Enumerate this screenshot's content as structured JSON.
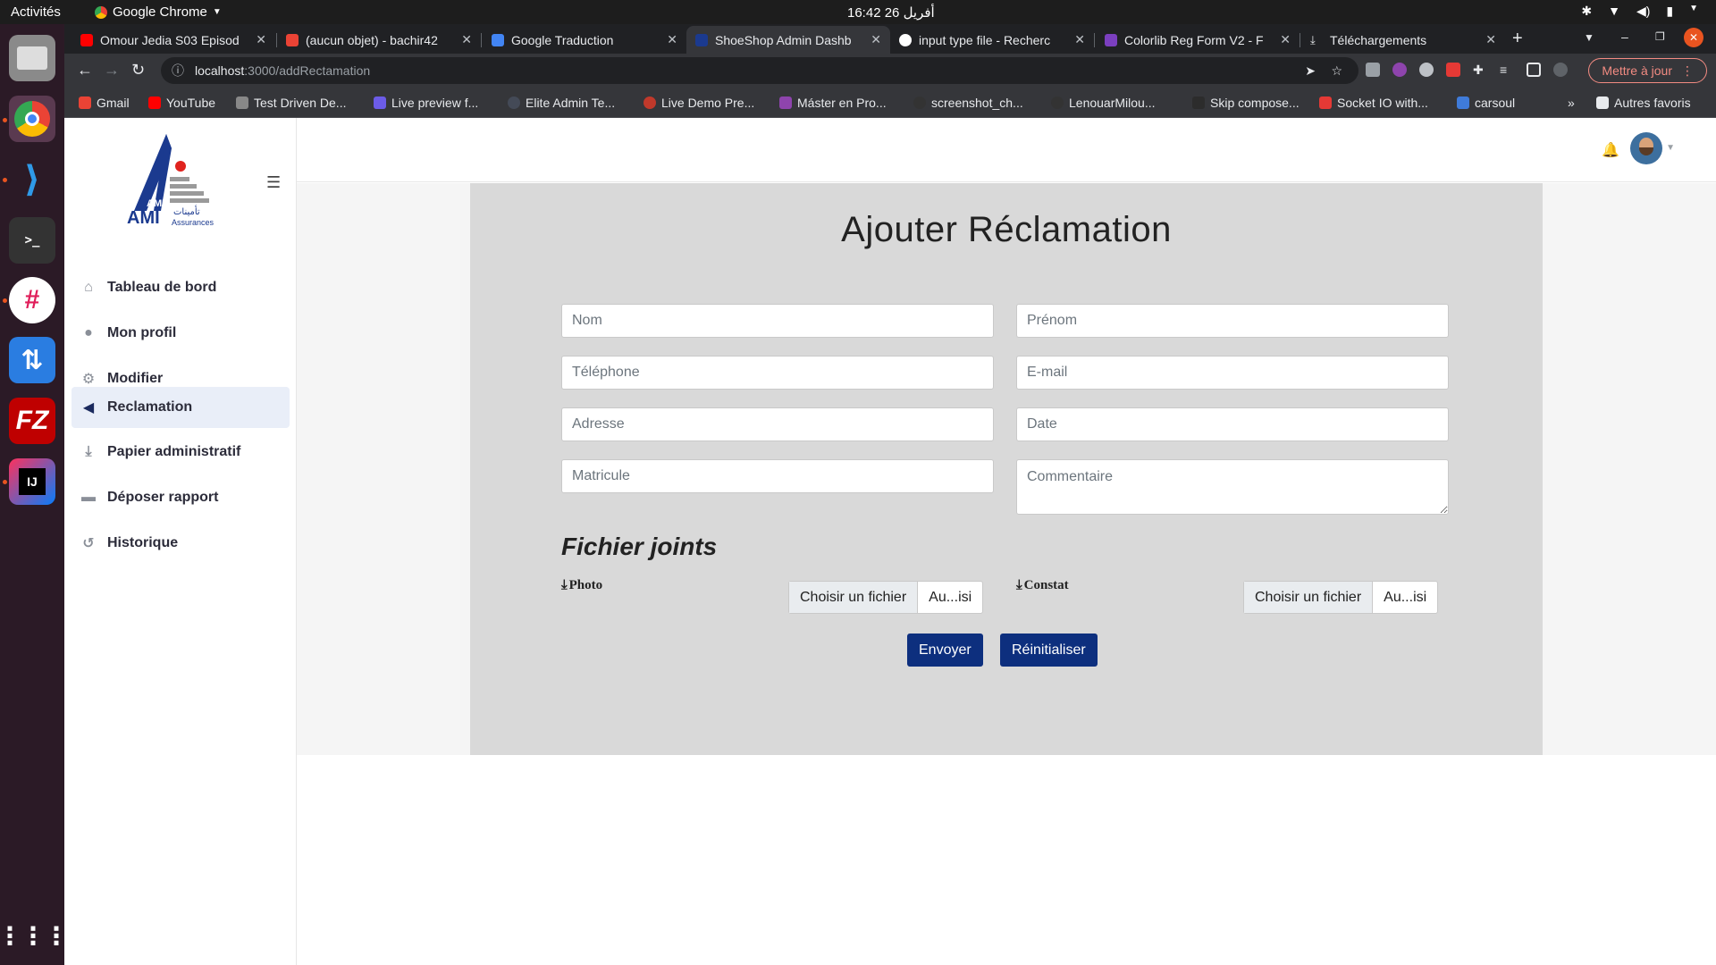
{
  "os": {
    "activities": "Activités",
    "app_name": "Google Chrome",
    "clock": "16:42  أفريل 26"
  },
  "browser": {
    "tabs": [
      {
        "label": "Omour Jedia S03 Episod",
        "color": "#ff0000"
      },
      {
        "label": "(aucun objet) - bachir42",
        "color": "#ea4335"
      },
      {
        "label": "Google Traduction",
        "color": "#4285f4"
      },
      {
        "label": "ShoeShop Admin Dashb",
        "color": "#1b3a8f"
      },
      {
        "label": "input type file - Recherc",
        "color": "#ffffff"
      },
      {
        "label": "Colorlib Reg Form V2 - F",
        "color": "#7b3fbf"
      },
      {
        "label": "Téléchargements",
        "color": "#e8eaed"
      }
    ],
    "url_host": "localhost",
    "url_path": ":3000/addRectamation",
    "update_label": "Mettre à jour",
    "bookmarks": [
      {
        "label": "Gmail",
        "color": "#ea4335"
      },
      {
        "label": "YouTube",
        "color": "#ff0000"
      },
      {
        "label": "Test Driven De...",
        "color": "#888888"
      },
      {
        "label": "Live preview f...",
        "color": "#6c5ce7"
      },
      {
        "label": "Elite Admin Te...",
        "color": "#444a57"
      },
      {
        "label": "Live Demo Pre...",
        "color": "#c0392b"
      },
      {
        "label": "Máster en Pro...",
        "color": "#8e44ad"
      },
      {
        "label": "screenshot_ch...",
        "color": "#333333"
      },
      {
        "label": "LenouarMilou...",
        "color": "#333333"
      },
      {
        "label": "Skip compose...",
        "color": "#2c2c2c"
      },
      {
        "label": "Socket IO with...",
        "color": "#e53935"
      },
      {
        "label": "carsoul",
        "color": "#3f7bd9"
      }
    ],
    "bookmarks_more": "»",
    "other_bookmarks": "Autres favoris"
  },
  "sidebar": {
    "brand": "AMI",
    "brand_sub": "Assurances",
    "brand_arabic": "تأمينات",
    "items": [
      {
        "label": "Tableau de bord",
        "icon": "home-icon",
        "glyph": "⌂"
      },
      {
        "label": "Mon profil",
        "icon": "user-icon",
        "glyph": "●"
      },
      {
        "label": "Modifier",
        "icon": "gear-icon",
        "glyph": "⚙"
      },
      {
        "label": "Reclamation",
        "icon": "megaphone-icon",
        "glyph": "📢"
      },
      {
        "label": "Papier administratif",
        "icon": "download-icon",
        "glyph": "⤓"
      },
      {
        "label": "Déposer rapport",
        "icon": "folder-icon",
        "glyph": "▬"
      },
      {
        "label": "Historique",
        "icon": "history-icon",
        "glyph": "↺"
      }
    ],
    "active_item": "Reclamation"
  },
  "form": {
    "title": "Ajouter Réclamation",
    "fields": {
      "nom": "Nom",
      "prenom": "Prénom",
      "telephone": "Téléphone",
      "email": "E-mail",
      "adresse": "Adresse",
      "date": "Date",
      "matricule": "Matricule",
      "commentaire": "Commentaire"
    },
    "attachments_title": "Fichier joints",
    "photo_label": "Photo",
    "constat_label": "Constat",
    "choose_file": "Choisir un fichier",
    "no_file": "Au...isi",
    "submit": "Envoyer",
    "reset": "Réinitialiser"
  }
}
